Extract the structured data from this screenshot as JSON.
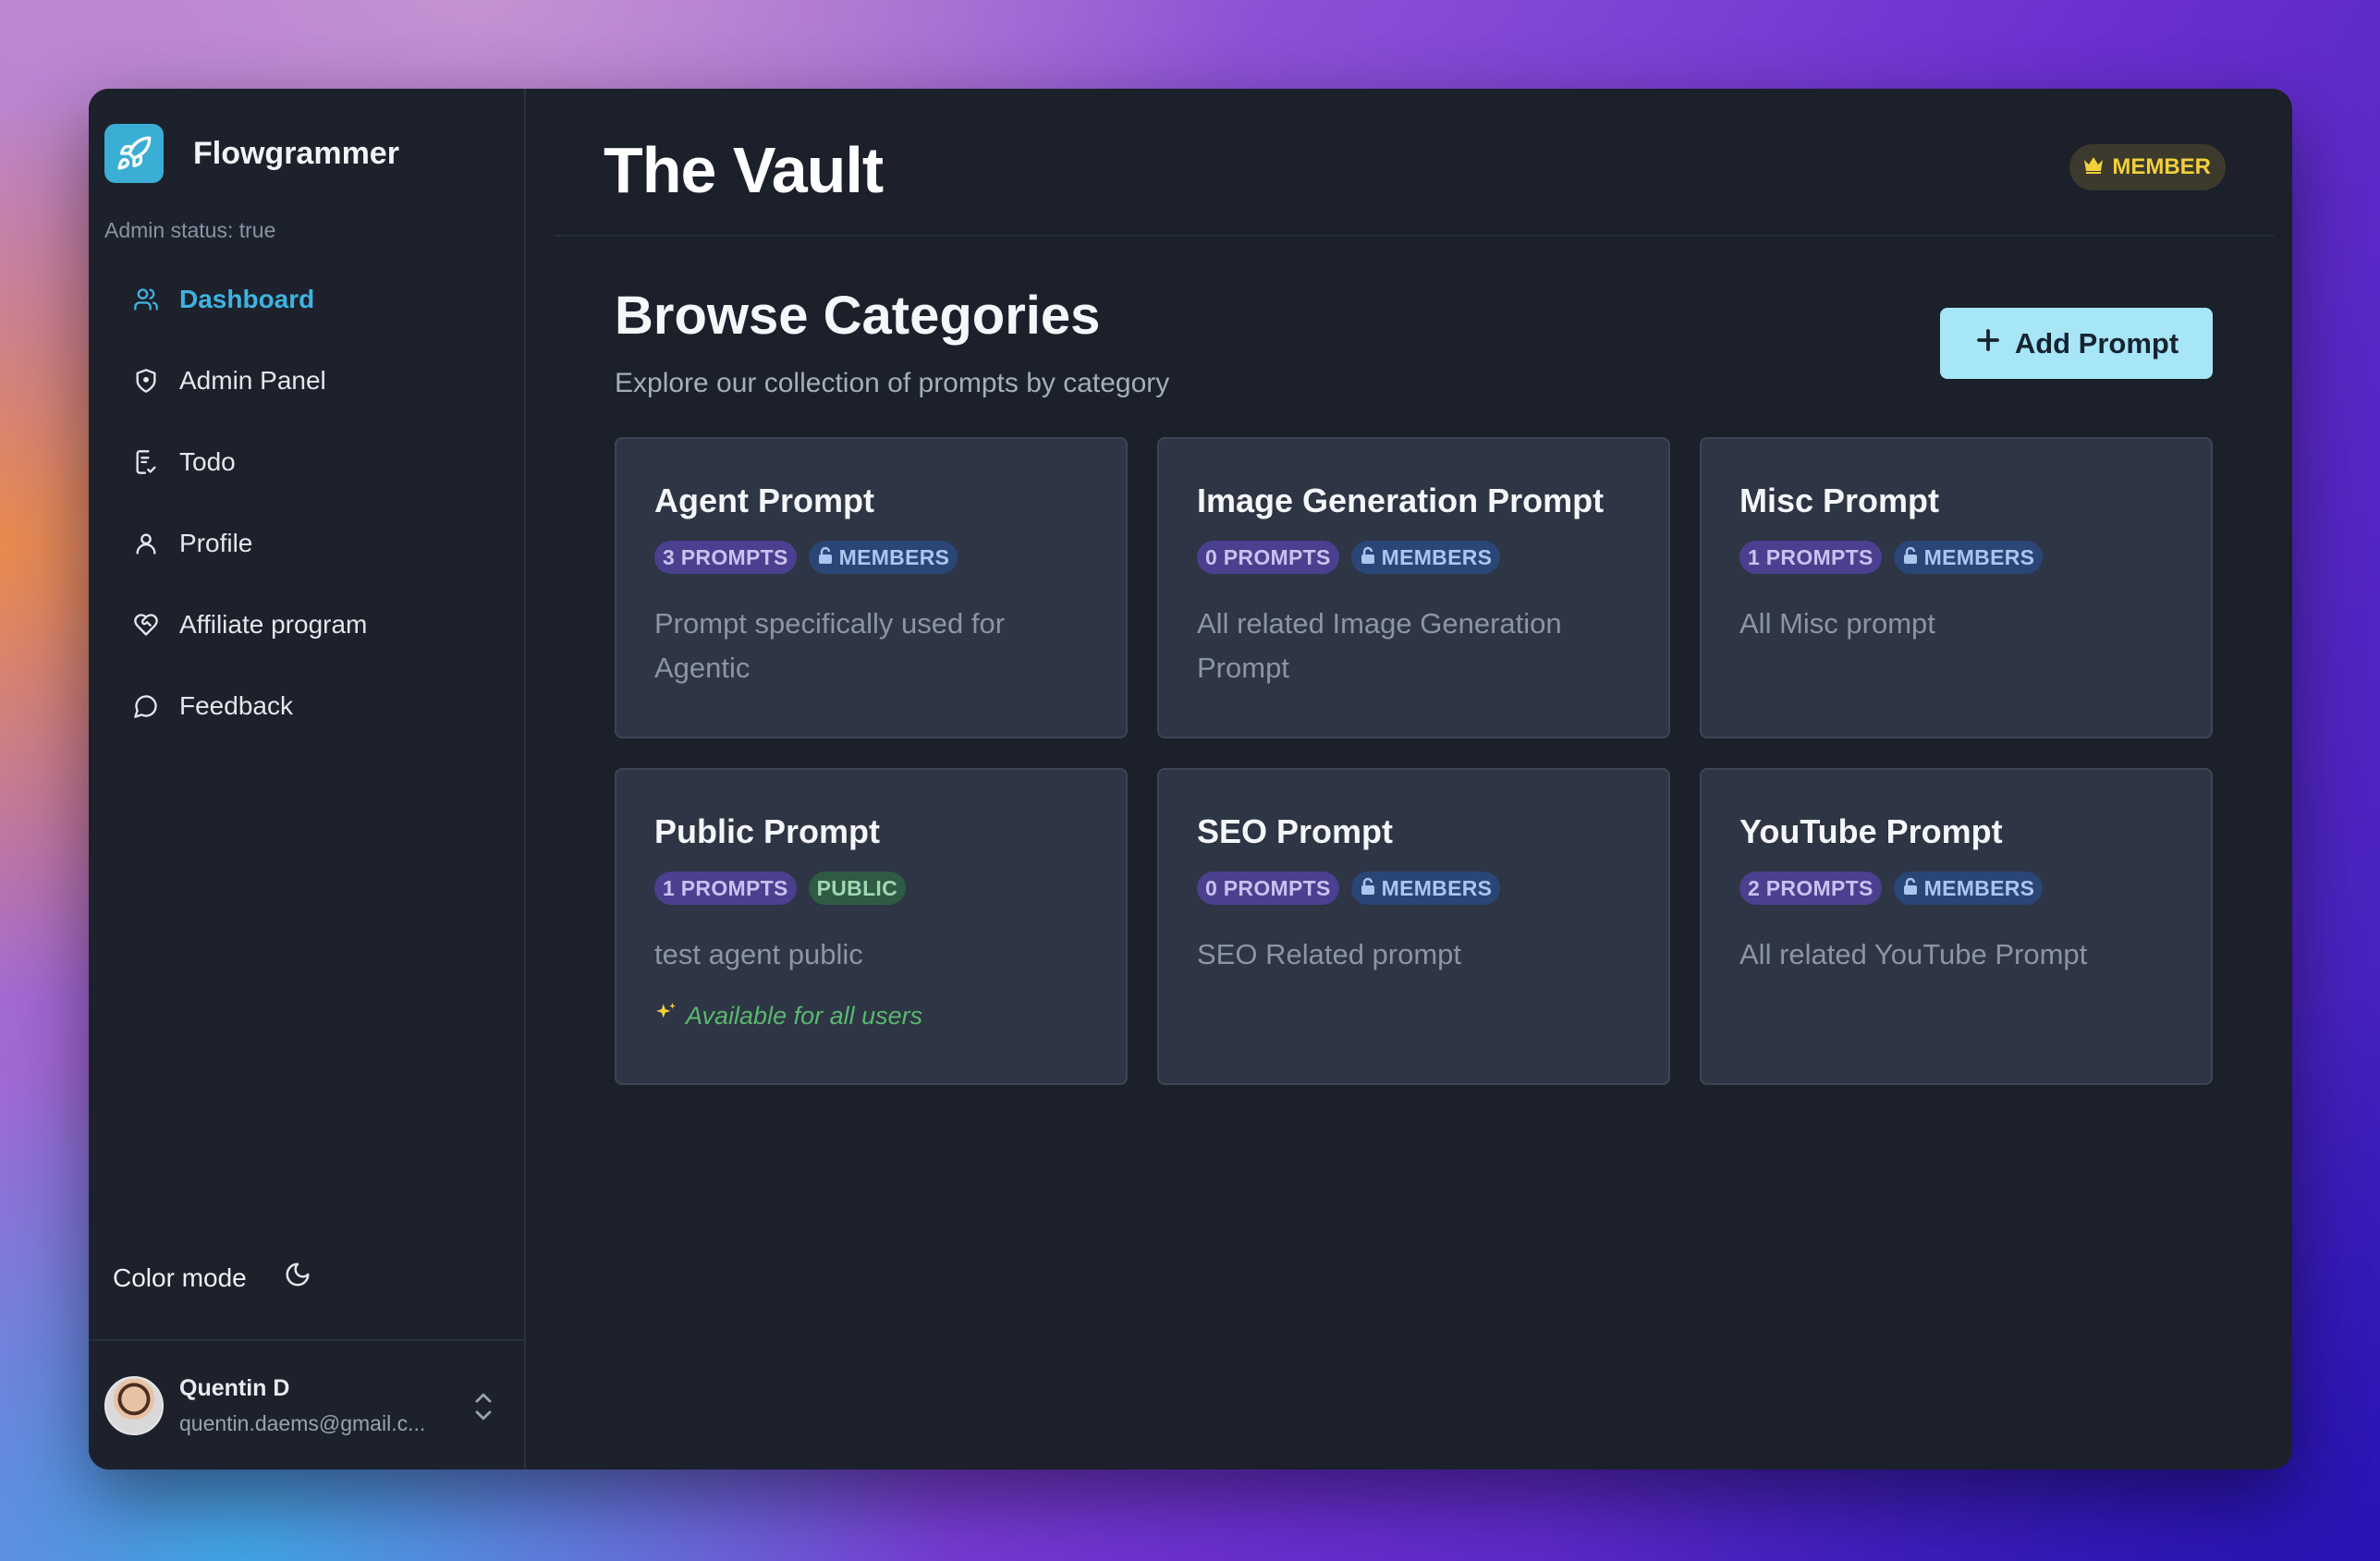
{
  "app": {
    "name": "Flowgrammer",
    "admin_status": "Admin status: true"
  },
  "sidebar": {
    "items": [
      {
        "label": "Dashboard",
        "icon": "users-icon",
        "active": true
      },
      {
        "label": "Admin Panel",
        "icon": "shield-icon"
      },
      {
        "label": "Todo",
        "icon": "clipboard-check-icon"
      },
      {
        "label": "Profile",
        "icon": "user-icon"
      },
      {
        "label": "Affiliate program",
        "icon": "heart-handshake-icon"
      },
      {
        "label": "Feedback",
        "icon": "message-circle-icon"
      }
    ],
    "color_mode_label": "Color mode"
  },
  "user": {
    "name": "Quentin D",
    "email": "quentin.daems@gmail.c..."
  },
  "header": {
    "title": "The Vault",
    "badge": "MEMBER"
  },
  "section": {
    "title": "Browse Categories",
    "subtitle": "Explore our collection of prompts by category",
    "add_button": "Add Prompt"
  },
  "categories": [
    {
      "title": "Agent Prompt",
      "count": "3 PROMPTS",
      "access": "MEMBERS",
      "desc": "Prompt specifically used for Agentic"
    },
    {
      "title": "Image Generation Prompt",
      "count": "0 PROMPTS",
      "access": "MEMBERS",
      "desc": "All related Image Generation Prompt"
    },
    {
      "title": "Misc Prompt",
      "count": "1 PROMPTS",
      "access": "MEMBERS",
      "desc": "All Misc prompt"
    },
    {
      "title": "Public Prompt",
      "count": "1 PROMPTS",
      "access": "PUBLIC",
      "desc": "test agent public",
      "note": "Available for all users"
    },
    {
      "title": "SEO Prompt",
      "count": "0 PROMPTS",
      "access": "MEMBERS",
      "desc": "SEO Related prompt"
    },
    {
      "title": "YouTube Prompt",
      "count": "2 PROMPTS",
      "access": "MEMBERS",
      "desc": "All related YouTube Prompt"
    }
  ],
  "colors": {
    "accent": "#3fb3e0",
    "button": "#a7e6f7",
    "member_gold": "#f2cf3c"
  }
}
